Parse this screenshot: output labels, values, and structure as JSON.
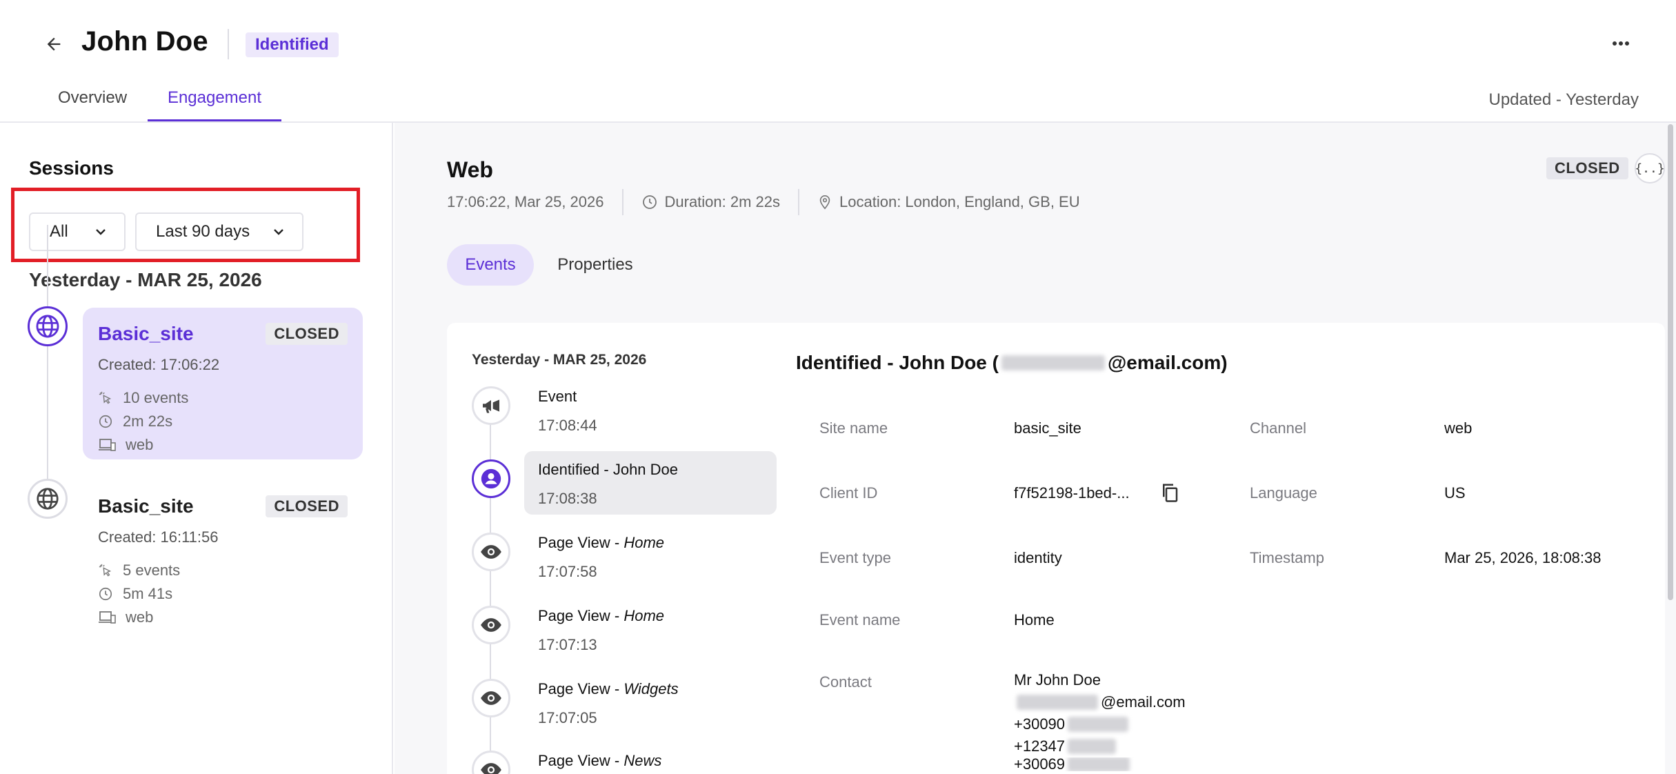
{
  "header": {
    "title": "John Doe",
    "status": "Identified",
    "tabs": [
      {
        "label": "Overview",
        "active": false
      },
      {
        "label": "Engagement",
        "active": true
      }
    ],
    "updated": "Updated - Yesterday",
    "icons": {
      "back": "arrow-left-icon",
      "more": "more-horizontal-icon"
    }
  },
  "sidebar": {
    "heading": "Sessions",
    "filters": {
      "type": "All",
      "range": "Last 90 days"
    },
    "date_group": "Yesterday - MAR 25, 2026",
    "sessions": [
      {
        "name": "Basic_site",
        "status": "CLOSED",
        "created": "Created: 17:06:22",
        "events": "10 events",
        "duration": "2m 22s",
        "channel": "web",
        "active": true
      },
      {
        "name": "Basic_site",
        "status": "CLOSED",
        "created": "Created: 16:11:56",
        "events": "5 events",
        "duration": "5m 41s",
        "channel": "web",
        "active": false
      }
    ]
  },
  "main": {
    "title": "Web",
    "timestamp": "17:06:22, Mar 25, 2026",
    "duration": "Duration: 2m 22s",
    "location": "Location: London, England, GB, EU",
    "status": "CLOSED",
    "json_button": "{..}",
    "tabs": [
      {
        "label": "Events",
        "active": true
      },
      {
        "label": "Properties",
        "active": false
      }
    ],
    "events_date": "Yesterday - MAR 25, 2026",
    "events": [
      {
        "label": "Event",
        "detail": "",
        "time": "17:08:44",
        "icon": "megaphone-icon"
      },
      {
        "label": "Identified - John Doe",
        "detail": "",
        "time": "17:08:38",
        "icon": "user-icon",
        "selected": true
      },
      {
        "label": "Page View - ",
        "detail": "Home",
        "time": "17:07:58",
        "icon": "eye-icon"
      },
      {
        "label": "Page View - ",
        "detail": "Home",
        "time": "17:07:13",
        "icon": "eye-icon"
      },
      {
        "label": "Page View - ",
        "detail": "Widgets",
        "time": "17:07:05",
        "icon": "eye-icon"
      },
      {
        "label": "Page View - ",
        "detail": "News",
        "time": "",
        "icon": "eye-icon"
      }
    ],
    "detail": {
      "title_prefix": "Identified - John Doe (",
      "title_suffix": "@email.com)",
      "fields": {
        "site_name_label": "Site name",
        "site_name": "basic_site",
        "channel_label": "Channel",
        "channel": "web",
        "client_id_label": "Client ID",
        "client_id": "f7f52198-1bed-...",
        "language_label": "Language",
        "language": "US",
        "event_type_label": "Event type",
        "event_type": "identity",
        "timestamp_label": "Timestamp",
        "timestamp": "Mar 25, 2026, 18:08:38",
        "event_name_label": "Event name",
        "event_name": "Home",
        "contact_label": "Contact",
        "contact_name": "Mr John Doe",
        "contact_email_suffix": "@email.com",
        "phone1_prefix": "+30090",
        "phone2_prefix": "+12347",
        "phone3_prefix": "+30069"
      }
    }
  },
  "colors": {
    "accent": "#5b2fd6",
    "accent_soft": "#e7e1fb",
    "highlight": "#e21e26"
  }
}
